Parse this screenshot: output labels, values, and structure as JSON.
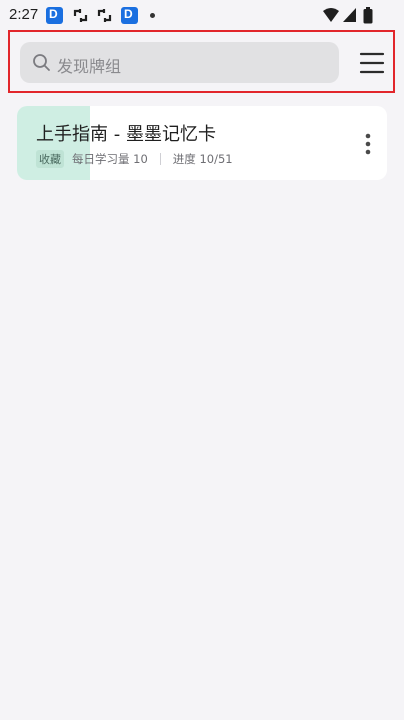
{
  "status_bar": {
    "time": "2:27",
    "notification_icons": [
      "d-app-icon",
      "sync-icon",
      "sync-icon",
      "d-app-icon"
    ],
    "d_glyph": "D",
    "system_icons": [
      "wifi-icon",
      "cell-signal-icon",
      "battery-icon"
    ]
  },
  "search": {
    "placeholder": "发现牌组"
  },
  "deck": {
    "title": "上手指南 - 墨墨记忆卡",
    "tag": "收藏",
    "daily_label": "每日学习量 10",
    "progress_label": "进度 10/51",
    "progress_fraction": 0.196
  },
  "colors": {
    "background": "#f5f4f7",
    "search_bg": "#e1e1e3",
    "card_bg": "#ffffff",
    "progress_fill": "#cfeee3",
    "tag_bg": "#bfe3d5",
    "highlight_border": "#e2262b",
    "notification_blue": "#1a6fe0"
  }
}
